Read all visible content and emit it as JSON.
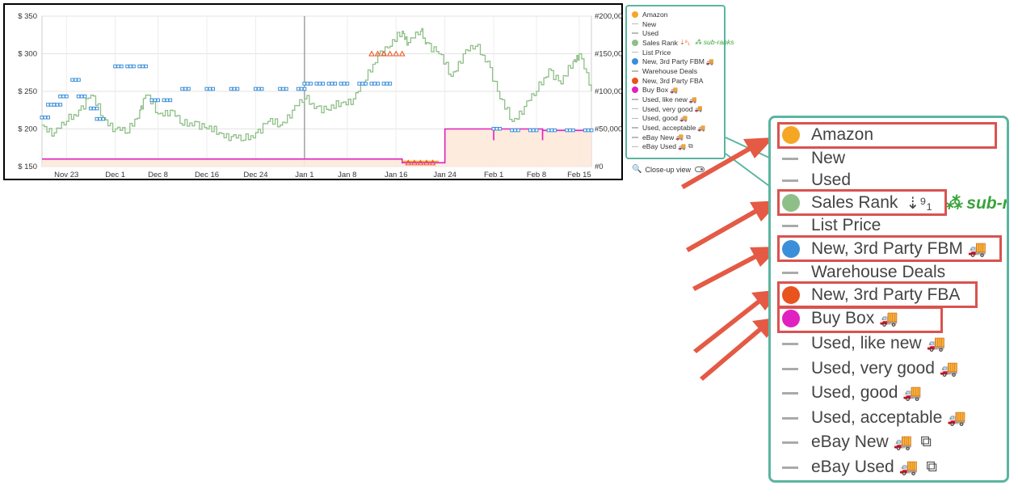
{
  "chart_data": {
    "type": "line",
    "x_ticks": [
      "Nov 23",
      "Dec 1",
      "Dec 8",
      "Dec 16",
      "Dec 24",
      "Jan 1",
      "Jan 8",
      "Jan 16",
      "Jan 24",
      "Feb 1",
      "Feb 8",
      "Feb 15"
    ],
    "y_left_ticks": [
      "$ 150",
      "$ 200",
      "$ 250",
      "$ 300",
      "$ 350"
    ],
    "y_left_range": [
      150,
      350
    ],
    "y_right_ticks": [
      "#0",
      "#50,000",
      "#100,000",
      "#150,000",
      "#200,000"
    ],
    "y_right_range": [
      0,
      200000
    ],
    "x_range_days": "Nov 19 – Feb 17",
    "grid": true,
    "legend_position": "right",
    "series": [
      {
        "name": "Sales Rank",
        "axis": "right",
        "color": "#8fbf88",
        "points": [
          [
            "Nov 19",
            55000
          ],
          [
            "Nov 21",
            45000
          ],
          [
            "Nov 23",
            60000
          ],
          [
            "Nov 25",
            75000
          ],
          [
            "Nov 27",
            95000
          ],
          [
            "Nov 29",
            65000
          ],
          [
            "Dec 1",
            50000
          ],
          [
            "Dec 3",
            45000
          ],
          [
            "Dec 5",
            75000
          ],
          [
            "Dec 6",
            95000
          ],
          [
            "Dec 8",
            70000
          ],
          [
            "Dec 10",
            75000
          ],
          [
            "Dec 12",
            55000
          ],
          [
            "Dec 14",
            60000
          ],
          [
            "Dec 16",
            50000
          ],
          [
            "Dec 18",
            45000
          ],
          [
            "Dec 20",
            40000
          ],
          [
            "Dec 22",
            35000
          ],
          [
            "Dec 24",
            45000
          ],
          [
            "Dec 26",
            60000
          ],
          [
            "Dec 28",
            55000
          ],
          [
            "Dec 30",
            75000
          ],
          [
            "Jan 1",
            90000
          ],
          [
            "Jan 3",
            80000
          ],
          [
            "Jan 5",
            75000
          ],
          [
            "Jan 7",
            85000
          ],
          [
            "Jan 9",
            90000
          ],
          [
            "Jan 11",
            115000
          ],
          [
            "Jan 13",
            150000
          ],
          [
            "Jan 15",
            160000
          ],
          [
            "Jan 17",
            180000
          ],
          [
            "Jan 18",
            165000
          ],
          [
            "Jan 20",
            180000
          ],
          [
            "Jan 21",
            165000
          ],
          [
            "Jan 23",
            150000
          ],
          [
            "Jan 25",
            120000
          ],
          [
            "Jan 27",
            150000
          ],
          [
            "Jan 29",
            160000
          ],
          [
            "Jan 31",
            140000
          ],
          [
            "Feb 2",
            90000
          ],
          [
            "Feb 4",
            60000
          ],
          [
            "Feb 6",
            80000
          ],
          [
            "Feb 8",
            100000
          ],
          [
            "Feb 10",
            130000
          ],
          [
            "Feb 12",
            110000
          ],
          [
            "Feb 14",
            140000
          ],
          [
            "Feb 15",
            150000
          ],
          [
            "Feb 17",
            100000
          ]
        ]
      },
      {
        "name": "New, 3rd Party FBM",
        "axis": "left",
        "color": "#3b8fd9",
        "style": "square-markers",
        "points": [
          [
            "Nov 19",
            215
          ],
          [
            "Nov 20",
            232
          ],
          [
            "Nov 21",
            232
          ],
          [
            "Nov 22",
            243
          ],
          [
            "Nov 24",
            265
          ],
          [
            "Nov 25",
            243
          ],
          [
            "Nov 27",
            227
          ],
          [
            "Nov 28",
            213
          ],
          [
            "Dec 1",
            283
          ],
          [
            "Dec 3",
            283
          ],
          [
            "Dec 5",
            283
          ],
          [
            "Dec 7",
            238
          ],
          [
            "Dec 9",
            238
          ],
          [
            "Dec 12",
            253
          ],
          [
            "Dec 16",
            253
          ],
          [
            "Dec 20",
            253
          ],
          [
            "Dec 24",
            253
          ],
          [
            "Dec 28",
            253
          ],
          [
            "Dec 31",
            253
          ],
          [
            "Jan 1",
            260
          ],
          [
            "Jan 3",
            260
          ],
          [
            "Jan 5",
            260
          ],
          [
            "Jan 7",
            260
          ],
          [
            "Jan 10",
            260
          ],
          [
            "Jan 12",
            260
          ],
          [
            "Jan 14",
            260
          ],
          [
            "Feb 1",
            200
          ],
          [
            "Feb 4",
            198
          ],
          [
            "Feb 7",
            198
          ],
          [
            "Feb 10",
            198
          ],
          [
            "Feb 13",
            198
          ],
          [
            "Feb 16",
            198
          ]
        ]
      },
      {
        "name": "New, 3rd Party FBA",
        "axis": "left",
        "color": "#e8531e",
        "style": "triangle-markers",
        "points": [
          [
            "Jan 12",
            300
          ],
          [
            "Jan 13",
            300
          ],
          [
            "Jan 14",
            300
          ],
          [
            "Jan 15",
            300
          ],
          [
            "Jan 16",
            300
          ],
          [
            "Jan 17",
            300
          ],
          [
            "Jan 18",
            155
          ],
          [
            "Jan 19",
            155
          ],
          [
            "Jan 20",
            155
          ],
          [
            "Jan 21",
            155
          ],
          [
            "Jan 22",
            155
          ]
        ]
      },
      {
        "name": "Buy Box",
        "axis": "left",
        "color": "#e020c0",
        "points": [
          [
            "Nov 19",
            160
          ],
          [
            "Jan 16",
            160
          ],
          [
            "Jan 17",
            155
          ],
          [
            "Jan 23",
            155
          ],
          [
            "Jan 24",
            200
          ],
          [
            "Jan 31",
            200
          ],
          [
            "Feb 1",
            198
          ],
          [
            "Feb 1",
            185
          ],
          [
            "Feb 1",
            200
          ],
          [
            "Feb 8",
            200
          ],
          [
            "Feb 9",
            185
          ],
          [
            "Feb 9",
            198
          ],
          [
            "Feb 17",
            198
          ]
        ]
      },
      {
        "name": "Amazon",
        "axis": "left",
        "color": "#f5a623",
        "points": [
          [
            "Jan 17",
            157
          ],
          [
            "Jan 23",
            157
          ]
        ]
      }
    ]
  },
  "small_legend": {
    "items": [
      {
        "label": "Amazon",
        "marker": "dot",
        "color": "#f5a623"
      },
      {
        "label": "New",
        "marker": "dash"
      },
      {
        "label": "Used",
        "marker": "dash"
      },
      {
        "label": "Sales Rank",
        "marker": "dot",
        "color": "#8fbf88",
        "sort_icon": "⇣⁹₁",
        "sub_ranks": "sub-ranks"
      },
      {
        "label": "List Price",
        "marker": "dash"
      },
      {
        "label": "New, 3rd Party FBM",
        "marker": "dot",
        "color": "#3b8fd9",
        "truck": "🚚"
      },
      {
        "label": "Warehouse Deals",
        "marker": "dash"
      },
      {
        "label": "New, 3rd Party FBA",
        "marker": "dot",
        "color": "#e8531e"
      },
      {
        "label": "Buy Box",
        "marker": "dot",
        "color": "#e020c0",
        "truck": "🚚"
      },
      {
        "label": "Used, like new",
        "marker": "dash",
        "truck": "🚚"
      },
      {
        "label": "Used, very good",
        "marker": "dash",
        "truck": "🚚"
      },
      {
        "label": "Used, good",
        "marker": "dash",
        "truck": "🚚"
      },
      {
        "label": "Used, acceptable",
        "marker": "dash",
        "truck": "🚚"
      },
      {
        "label": "eBay New",
        "marker": "dash",
        "truck": "🚚",
        "ext": "⧉"
      },
      {
        "label": "eBay Used",
        "marker": "dash",
        "truck": "🚚",
        "ext": "⧉"
      }
    ],
    "closeup_label": "Close-up view"
  },
  "zoom_legend": {
    "items": [
      {
        "label": "Amazon",
        "marker": "dot",
        "color": "#f5a623"
      },
      {
        "label": "New",
        "marker": "dash"
      },
      {
        "label": "Used",
        "marker": "dash"
      },
      {
        "label": "Sales Rank",
        "marker": "dot",
        "color": "#8fbf88",
        "sort_icon": "⇣⁹₁",
        "sub_ranks": "sub-r"
      },
      {
        "label": "List Price",
        "marker": "dash"
      },
      {
        "label": "New, 3rd Party FBM",
        "marker": "dot",
        "color": "#3b8fd9",
        "truck": "🚚"
      },
      {
        "label": "Warehouse Deals",
        "marker": "dash"
      },
      {
        "label": "New, 3rd Party FBA",
        "marker": "dot",
        "color": "#e8531e"
      },
      {
        "label": "Buy Box",
        "marker": "dot",
        "color": "#e020c0",
        "truck": "🚚"
      },
      {
        "label": "Used, like new",
        "marker": "dash",
        "truck": "🚚"
      },
      {
        "label": "Used, very good",
        "marker": "dash",
        "truck": "🚚"
      },
      {
        "label": "Used, good",
        "marker": "dash",
        "truck": "🚚"
      },
      {
        "label": "Used, acceptable",
        "marker": "dash",
        "truck": "🚚"
      },
      {
        "label": "eBay New",
        "marker": "dash",
        "truck": "🚚",
        "ext": "⧉"
      },
      {
        "label": "eBay Used",
        "marker": "dash",
        "truck": "🚚",
        "ext": "⧉"
      }
    ],
    "highlighted": [
      "Amazon",
      "Sales Rank",
      "New, 3rd Party FBM",
      "New, 3rd Party FBA",
      "Buy Box"
    ],
    "highlight_color": "#d9534f",
    "frame_color": "#5bb5a0"
  }
}
